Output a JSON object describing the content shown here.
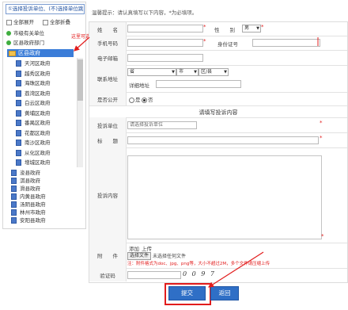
{
  "tree": {
    "header": "①选择投诉单位、(不)选择单位跳过",
    "expand_all": "全部展开",
    "collapse_all": "全部折叠",
    "groups": [
      "市级有关单位",
      "区县政府部门"
    ],
    "selected": "区县政府",
    "children": [
      "天河区政府",
      "越秀区政府",
      "海珠区政府",
      "荔湾区政府",
      "白云区政府",
      "黄埔区政府",
      "番禺区政府",
      "花都区政府",
      "南沙区政府",
      "从化区政府",
      "增城区政府"
    ],
    "more_items": [
      "浚县政府",
      "淇县政府",
      "滑县政府",
      "内黄县政府",
      "汤阴县政府",
      "林州市政府",
      "安阳县政府"
    ]
  },
  "annotation": {
    "tree_hint": "这里可选择投诉单位"
  },
  "form": {
    "note": "温馨提示：请认真填写以下内容，*为必填项。",
    "name_label": "姓　　名",
    "gender_label": "性　　别",
    "gender_value": "男",
    "phone_label": "手机号码",
    "id_label": "身份证号",
    "email_label": "电子邮箱",
    "address_label": "联系地址",
    "province": "省",
    "city": "市",
    "district": "区/县",
    "detail_label": "详细地址",
    "public_label": "是否公开",
    "public_yes": "是",
    "public_no": "否",
    "section_title": "请填写投诉内容",
    "unit_label": "投诉单位",
    "unit_value": "请选择投诉单位",
    "title_label": "标　　题",
    "content_label": "投诉内容",
    "attach_label": "附　　件",
    "attach_add": "添加",
    "attach_upload": "上传",
    "file_button": "选择文件",
    "file_status": "未选择任何文件",
    "attach_note": "注：附件格式为doc、jpg、png等，大小不超过2M，多个文件请压缩上传",
    "captcha_label": "验证码",
    "captcha_value": "0 0 9 7",
    "required_mark": "*"
  },
  "buttons": {
    "submit": "提交",
    "back": "返回"
  },
  "colors": {
    "accent": "#2f6fc6",
    "selected_bg": "#3b7dd8",
    "annotation": "#e21c1c"
  }
}
